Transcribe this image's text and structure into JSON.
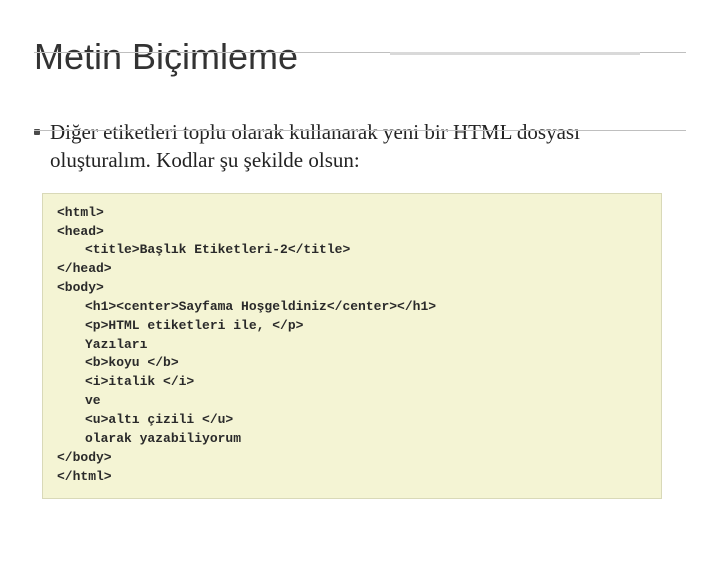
{
  "slide": {
    "title": "Metin Biçimleme",
    "bullet": "Diğer etiketleri toplu olarak kullanarak yeni bir HTML dosyası oluşturalım. Kodlar şu şekilde olsun:",
    "code": {
      "l01": "<html>",
      "l02": "<head>",
      "l03": "<title>Başlık Etiketleri-2</title>",
      "l04": "</head>",
      "l05": "<body>",
      "l06": "<h1><center>Sayfama Hoşgeldiniz</center></h1>",
      "l07": "<p>HTML etiketleri ile, </p>",
      "l08": "Yazıları",
      "l09": "<b>koyu </b>",
      "l10": "<i>italik </i>",
      "l11": "ve",
      "l12": "<u>altı çizili </u>",
      "l13": "olarak yazabiliyorum",
      "l14": "</body>",
      "l15": "</html>"
    }
  }
}
